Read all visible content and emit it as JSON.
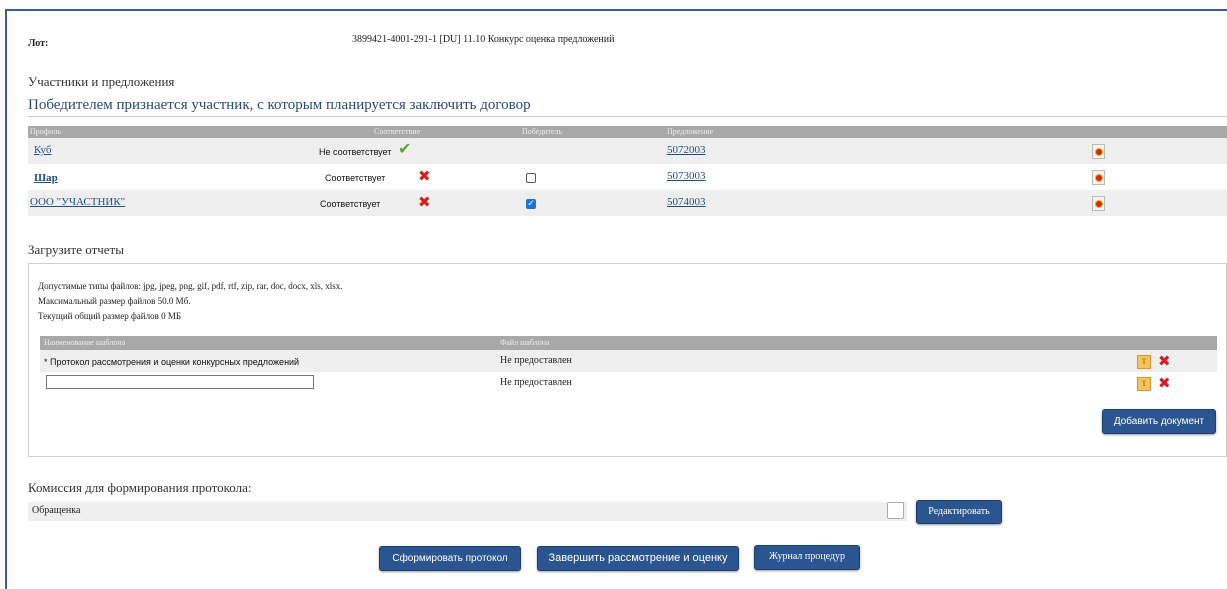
{
  "lot": {
    "label": "Лот:",
    "value": "3899421-4001-291-1 [DU] 11.10 Конкурс оценка предложений"
  },
  "participants": {
    "section_title": "Участники и предложения",
    "winner_title": "Победителем признается участник, с которым планируется заключить договор",
    "columns": {
      "profile": "Профиль",
      "compliance": "Соответствие",
      "winner": "Победитель",
      "offer": "Предложение"
    },
    "rows": [
      {
        "name": "Куб",
        "compliance": "Не соответствует",
        "compliance_icon": "green-check-icon",
        "winner_checkbox": null,
        "offer": "5072003"
      },
      {
        "name": "Шар",
        "compliance": "Соответствует",
        "compliance_icon": "red-x-icon",
        "winner_checkbox": false,
        "offer": "5073003"
      },
      {
        "name": "ООО \"УЧАСТНИК\"",
        "compliance": "Соответствует",
        "compliance_icon": "red-x-icon",
        "winner_checkbox": true,
        "offer": "5074003"
      }
    ]
  },
  "upload": {
    "title": "Загрузите отчеты",
    "allowed_types": "Допустимые типы файлов: jpg, jpeg, png, gif, pdf, rtf, zip, rar, doc, docx, xls, xlsx.",
    "max_size": "Максимальный размер файлов 50.0 Мб.",
    "current_size": "Текущий общий размер файлов  0 МБ",
    "columns": {
      "template_name": "Наименование шаблона",
      "template_file": "Файл шаблона"
    },
    "rows": [
      {
        "name": "* Протокол рассмотрения и оценки конкурсных предложений",
        "file": "Не предоставлен"
      },
      {
        "name": "",
        "file": "Не предоставлен"
      }
    ],
    "add_button": "Добавить документ"
  },
  "commission": {
    "title": "Комиссия для формирования протокола:",
    "value": "Обращенка",
    "edit_button": "Редактировать"
  },
  "actions": {
    "form_protocol": "Сформировать протокол",
    "finish_review": "Завершить рассмотрение и оценку",
    "journal": "Журнал процедур"
  },
  "colors": {
    "accent": "#2b5591",
    "header_gray": "#a8a8a8",
    "link": "#1f4f9a",
    "reject": "#d81e1e",
    "accept": "#5aa62c"
  }
}
